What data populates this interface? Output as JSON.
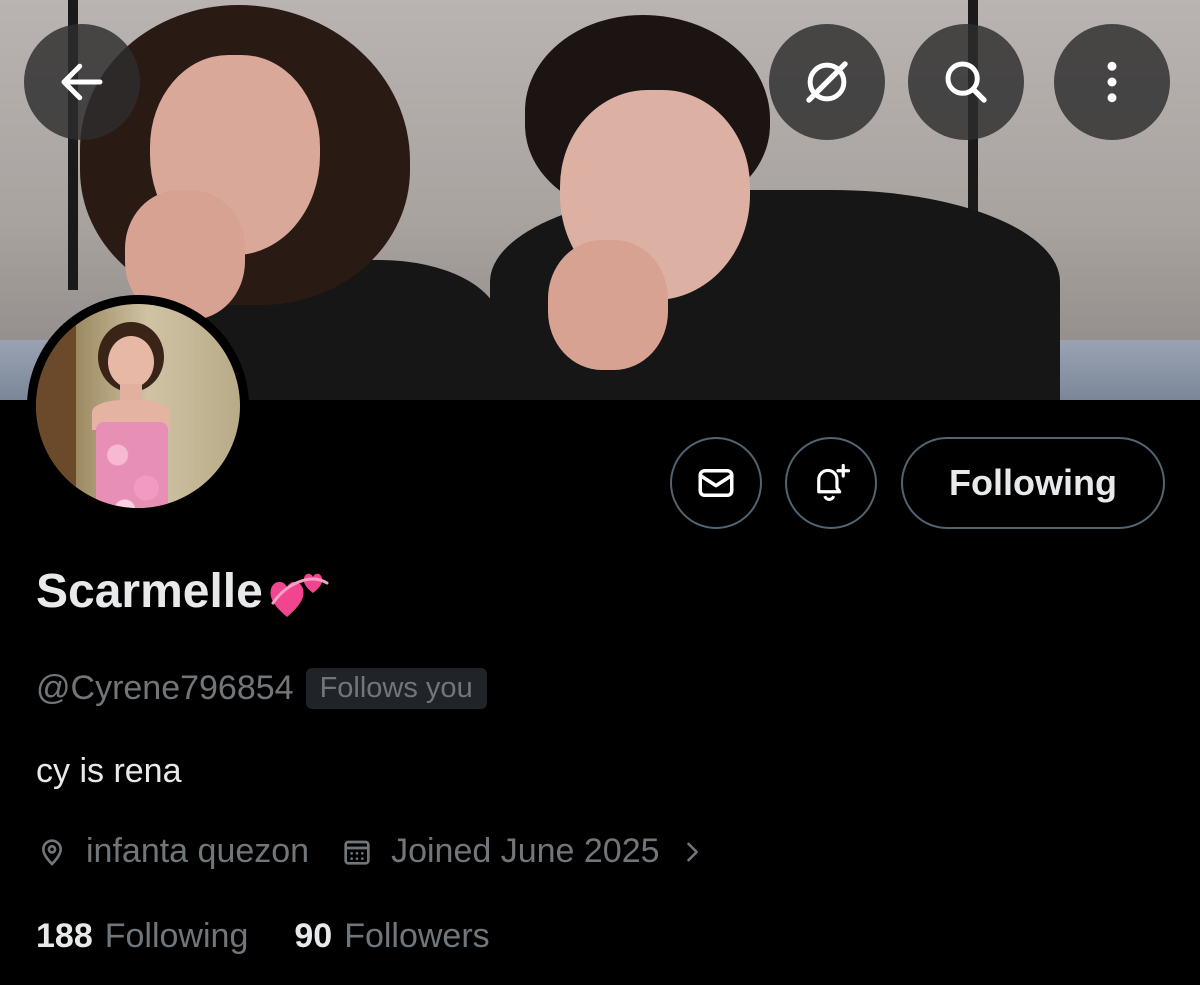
{
  "profile": {
    "display_name": "Scarmelle",
    "name_emoji": "two-hearts-emoji",
    "handle": "@Cyrene796854",
    "follows_you_badge": "Follows you",
    "bio": "cy is rena",
    "location": "infanta quezon",
    "joined": "Joined June 2025",
    "following_count": "188",
    "following_label": "Following",
    "followers_count": "90",
    "followers_label": "Followers"
  },
  "actions": {
    "follow_state_label": "Following"
  },
  "icons": {
    "back": "arrow-left-icon",
    "grok": "slashed-circle-icon",
    "search": "search-icon",
    "more": "more-vertical-icon",
    "message": "envelope-icon",
    "notify": "bell-plus-icon",
    "location": "location-pin-icon",
    "calendar": "calendar-icon",
    "chevron": "chevron-right-icon"
  },
  "colors": {
    "background": "#000000",
    "text_primary": "#e7e9ea",
    "text_secondary": "#71767b",
    "button_border": "#536471",
    "badge_bg": "#202327"
  }
}
